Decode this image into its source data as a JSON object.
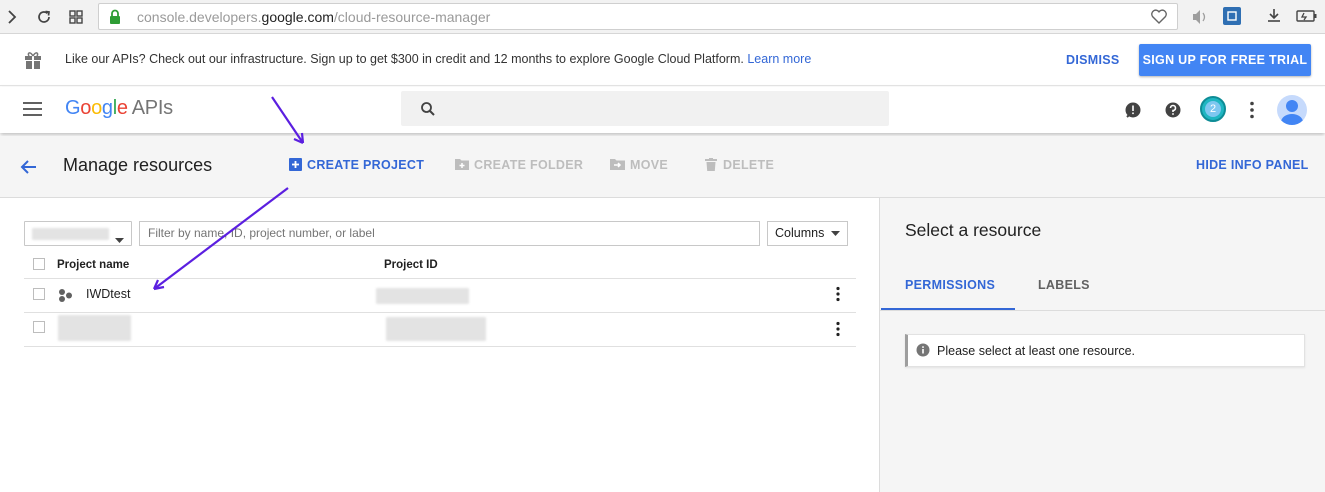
{
  "browser": {
    "url_prefix": "console.developers.",
    "url_domain": "google.com",
    "url_path": "/cloud-resource-manager"
  },
  "promo": {
    "message": "Like our APIs? Check out our infrastructure. Sign up to get $300 in credit and 12 months to explore Google Cloud Platform.",
    "link": "Learn more",
    "dismiss": "DISMISS",
    "cta": "SIGN UP FOR FREE TRIAL"
  },
  "header": {
    "logo": "Google",
    "logo_suffix": "APIs",
    "notification_count": "2"
  },
  "toolbar": {
    "title": "Manage resources",
    "create_project": "CREATE PROJECT",
    "create_folder": "CREATE FOLDER",
    "move": "MOVE",
    "delete": "DELETE",
    "hide_info_panel": "HIDE INFO PANEL"
  },
  "filter": {
    "placeholder": "Filter by name, ID, project number, or label",
    "columns_label": "Columns"
  },
  "table": {
    "headers": [
      "Project name",
      "Project ID"
    ],
    "rows": [
      {
        "name": "IWDtest",
        "id": ""
      },
      {
        "name": "",
        "id": ""
      }
    ]
  },
  "info_panel": {
    "title": "Select a resource",
    "tabs": [
      "PERMISSIONS",
      "LABELS"
    ],
    "notice": "Please select at least one resource."
  },
  "colors": {
    "accent": "#3367d6",
    "cta_bg": "#4285f4",
    "annotation_arrow": "#5b1fe0"
  }
}
